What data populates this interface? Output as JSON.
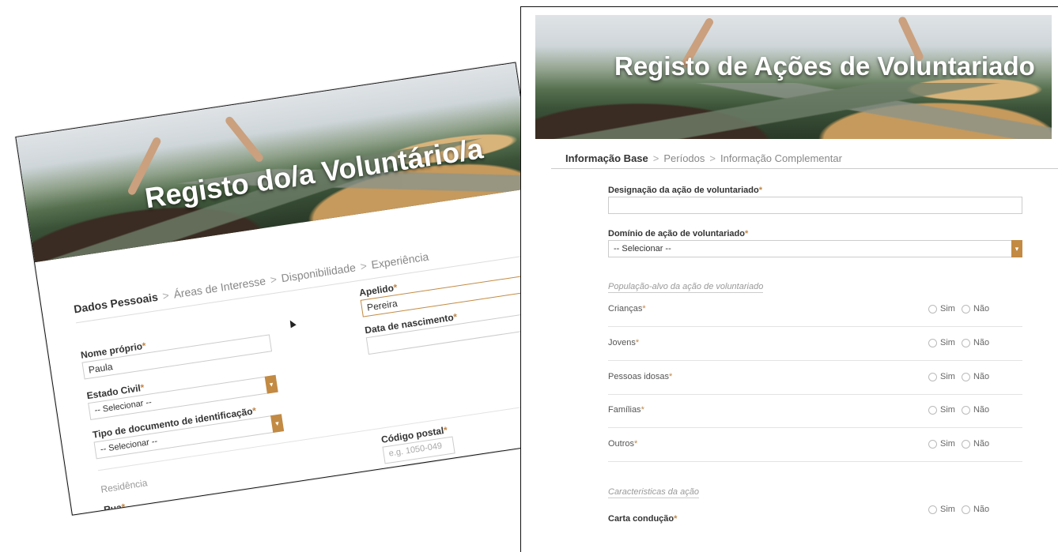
{
  "left_form": {
    "banner_title": "Registo do/a Voluntário/a",
    "breadcrumb": [
      "Dados Pessoais",
      "Áreas de Interesse",
      "Disponibilidade",
      "Experiência"
    ],
    "fields": {
      "nome_label": "Nome próprio",
      "nome_value": "Paula",
      "apelido_label": "Apelido",
      "apelido_value": "Pereira",
      "data_label": "Data de nascimento",
      "estado_label": "Estado Civil",
      "estado_value": "-- Selecionar --",
      "tipo_doc_label": "Tipo de documento de identificação",
      "tipo_doc_value": "-- Selecionar --",
      "residencia_label": "Residência",
      "codigo_label": "Código postal",
      "codigo_placeholder": "e.g. 1050-049",
      "rua_label": "Rua"
    }
  },
  "right_form": {
    "banner_title": "Registo de Ações de Voluntariado",
    "breadcrumb": [
      "Informação Base",
      "Períodos",
      "Informação Complementar"
    ],
    "designacao_label": "Designação da ação de voluntariado",
    "dominio_label": "Domínio de ação de voluntariado",
    "dominio_value": "-- Selecionar --",
    "populacao_label": "População-alvo da ação de voluntariado",
    "rows": [
      {
        "label": "Crianças"
      },
      {
        "label": "Jovens"
      },
      {
        "label": "Pessoas idosas"
      },
      {
        "label": "Famílias"
      },
      {
        "label": "Outros"
      }
    ],
    "radio_yes": "Sim",
    "radio_no": "Não",
    "caracteristicas_label": "Caracteristicas da ação",
    "carta_label": "Carta condução"
  },
  "required_marker": "*",
  "crumb_separator": ">",
  "colors": {
    "accent": "#c28a43",
    "text": "#333333",
    "muted": "#999999"
  }
}
